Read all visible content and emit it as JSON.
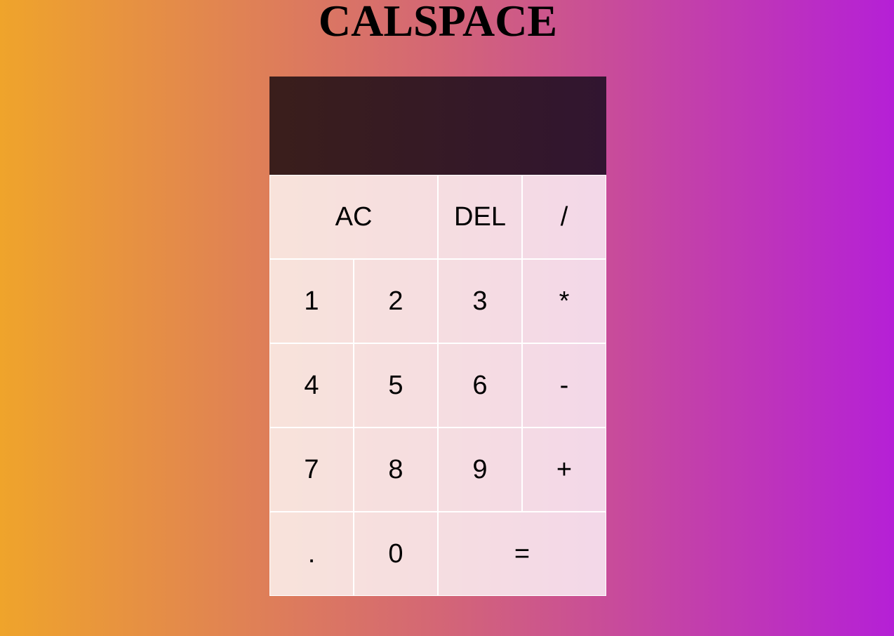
{
  "app": {
    "title": "CALSPACE"
  },
  "display": {
    "previous": "",
    "current": ""
  },
  "keys": {
    "ac": "AC",
    "del": "DEL",
    "divide": "/",
    "one": "1",
    "two": "2",
    "three": "3",
    "multiply": "*",
    "four": "4",
    "five": "5",
    "six": "6",
    "subtract": "-",
    "seven": "7",
    "eight": "8",
    "nine": "9",
    "add": "+",
    "decimal": ".",
    "zero": "0",
    "equals": "="
  },
  "colors": {
    "background_left": "#EFA42B",
    "background_mid": "#D36577",
    "background_right": "#B520D6",
    "display_left": "#3A1E1B",
    "display_right": "#311530",
    "key_background": "#F5DCDC",
    "key_border": "#FFFFFF"
  }
}
